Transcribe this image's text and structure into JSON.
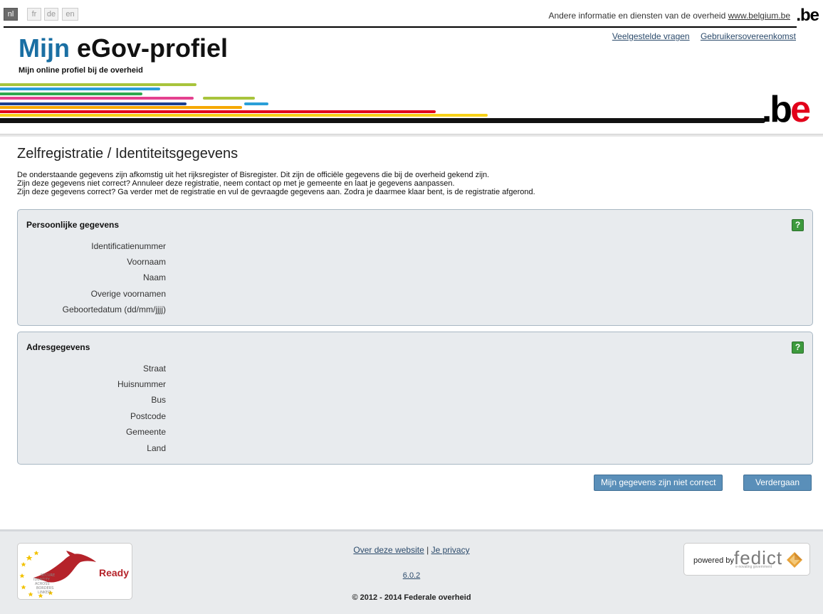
{
  "languages": [
    "nl",
    "fr",
    "de",
    "en"
  ],
  "active_language": "nl",
  "top": {
    "gov_info_text": "Andere informatie en diensten van de overheid",
    "gov_info_link": "www.belgium.be",
    "be_logo": ".be"
  },
  "header": {
    "links": [
      "Veelgestelde vragen",
      "Gebruikersovereenkomst"
    ],
    "title_first": "Mijn",
    "title_rest": "eGov-profiel",
    "subtitle": "Mijn online profiel bij de overheid",
    "big_be_b": ".b",
    "big_be_e": "e",
    "stripe_colors": [
      "#a8c43c",
      "#2a9fd8",
      "#2fa84f",
      "#e4418f",
      "#1a3f8f",
      "#f6a800",
      "#e2001a",
      "#f7d117",
      "#111111"
    ]
  },
  "main": {
    "title": "Zelfregistratie / Identiteitsgegevens",
    "intro": [
      "De onderstaande gegevens zijn afkomstig uit het rijksregister of Bisregister. Dit zijn de officiële gegevens die bij de overheid gekend zijn.",
      "Zijn deze gegevens niet correct? Annuleer deze registratie, neem contact op met je gemeente en laat je gegevens aanpassen.",
      "Zijn deze gegevens correct? Ga verder met de registratie en vul de gevraagde gegevens aan. Zodra je daarmee klaar bent, is de registratie afgerond."
    ],
    "personal": {
      "title": "Persoonlijke gegevens",
      "help": "?",
      "fields": [
        "Identificatienummer",
        "Voornaam",
        "Naam",
        "Overige voornamen",
        "Geboortedatum (dd/mm/jjjj)"
      ]
    },
    "address": {
      "title": "Adresgegevens",
      "help": "?",
      "fields": [
        "Straat",
        "Huisnummer",
        "Bus",
        "Postcode",
        "Gemeente",
        "Land"
      ]
    },
    "buttons": {
      "not_correct": "Mijn gegevens zijn niet correct",
      "next": "Verdergaan"
    }
  },
  "footer": {
    "about": "Over deze website",
    "separator": "|",
    "privacy": "Je privacy",
    "version": "6.0.2",
    "copyright": "© 2012 - 2014 Federale overheid",
    "ready_text": "Ready",
    "ready_logo_text": "SECURE IDENTITY ACROSS BORDERS LINKED",
    "powered_by": "powered by",
    "fedict": "fedict",
    "fedict_tagline": "e-novating government"
  }
}
